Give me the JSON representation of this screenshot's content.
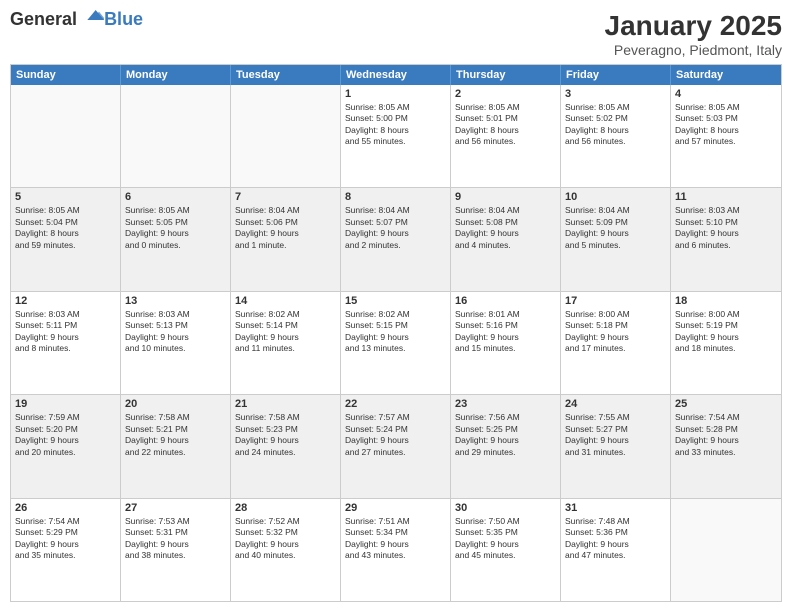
{
  "logo": {
    "line1": "General",
    "line2": "Blue"
  },
  "title": "January 2025",
  "subtitle": "Peveragno, Piedmont, Italy",
  "days": [
    "Sunday",
    "Monday",
    "Tuesday",
    "Wednesday",
    "Thursday",
    "Friday",
    "Saturday"
  ],
  "weeks": [
    [
      {
        "day": "",
        "info": ""
      },
      {
        "day": "",
        "info": ""
      },
      {
        "day": "",
        "info": ""
      },
      {
        "day": "1",
        "info": "Sunrise: 8:05 AM\nSunset: 5:00 PM\nDaylight: 8 hours\nand 55 minutes."
      },
      {
        "day": "2",
        "info": "Sunrise: 8:05 AM\nSunset: 5:01 PM\nDaylight: 8 hours\nand 56 minutes."
      },
      {
        "day": "3",
        "info": "Sunrise: 8:05 AM\nSunset: 5:02 PM\nDaylight: 8 hours\nand 56 minutes."
      },
      {
        "day": "4",
        "info": "Sunrise: 8:05 AM\nSunset: 5:03 PM\nDaylight: 8 hours\nand 57 minutes."
      }
    ],
    [
      {
        "day": "5",
        "info": "Sunrise: 8:05 AM\nSunset: 5:04 PM\nDaylight: 8 hours\nand 59 minutes."
      },
      {
        "day": "6",
        "info": "Sunrise: 8:05 AM\nSunset: 5:05 PM\nDaylight: 9 hours\nand 0 minutes."
      },
      {
        "day": "7",
        "info": "Sunrise: 8:04 AM\nSunset: 5:06 PM\nDaylight: 9 hours\nand 1 minute."
      },
      {
        "day": "8",
        "info": "Sunrise: 8:04 AM\nSunset: 5:07 PM\nDaylight: 9 hours\nand 2 minutes."
      },
      {
        "day": "9",
        "info": "Sunrise: 8:04 AM\nSunset: 5:08 PM\nDaylight: 9 hours\nand 4 minutes."
      },
      {
        "day": "10",
        "info": "Sunrise: 8:04 AM\nSunset: 5:09 PM\nDaylight: 9 hours\nand 5 minutes."
      },
      {
        "day": "11",
        "info": "Sunrise: 8:03 AM\nSunset: 5:10 PM\nDaylight: 9 hours\nand 6 minutes."
      }
    ],
    [
      {
        "day": "12",
        "info": "Sunrise: 8:03 AM\nSunset: 5:11 PM\nDaylight: 9 hours\nand 8 minutes."
      },
      {
        "day": "13",
        "info": "Sunrise: 8:03 AM\nSunset: 5:13 PM\nDaylight: 9 hours\nand 10 minutes."
      },
      {
        "day": "14",
        "info": "Sunrise: 8:02 AM\nSunset: 5:14 PM\nDaylight: 9 hours\nand 11 minutes."
      },
      {
        "day": "15",
        "info": "Sunrise: 8:02 AM\nSunset: 5:15 PM\nDaylight: 9 hours\nand 13 minutes."
      },
      {
        "day": "16",
        "info": "Sunrise: 8:01 AM\nSunset: 5:16 PM\nDaylight: 9 hours\nand 15 minutes."
      },
      {
        "day": "17",
        "info": "Sunrise: 8:00 AM\nSunset: 5:18 PM\nDaylight: 9 hours\nand 17 minutes."
      },
      {
        "day": "18",
        "info": "Sunrise: 8:00 AM\nSunset: 5:19 PM\nDaylight: 9 hours\nand 18 minutes."
      }
    ],
    [
      {
        "day": "19",
        "info": "Sunrise: 7:59 AM\nSunset: 5:20 PM\nDaylight: 9 hours\nand 20 minutes."
      },
      {
        "day": "20",
        "info": "Sunrise: 7:58 AM\nSunset: 5:21 PM\nDaylight: 9 hours\nand 22 minutes."
      },
      {
        "day": "21",
        "info": "Sunrise: 7:58 AM\nSunset: 5:23 PM\nDaylight: 9 hours\nand 24 minutes."
      },
      {
        "day": "22",
        "info": "Sunrise: 7:57 AM\nSunset: 5:24 PM\nDaylight: 9 hours\nand 27 minutes."
      },
      {
        "day": "23",
        "info": "Sunrise: 7:56 AM\nSunset: 5:25 PM\nDaylight: 9 hours\nand 29 minutes."
      },
      {
        "day": "24",
        "info": "Sunrise: 7:55 AM\nSunset: 5:27 PM\nDaylight: 9 hours\nand 31 minutes."
      },
      {
        "day": "25",
        "info": "Sunrise: 7:54 AM\nSunset: 5:28 PM\nDaylight: 9 hours\nand 33 minutes."
      }
    ],
    [
      {
        "day": "26",
        "info": "Sunrise: 7:54 AM\nSunset: 5:29 PM\nDaylight: 9 hours\nand 35 minutes."
      },
      {
        "day": "27",
        "info": "Sunrise: 7:53 AM\nSunset: 5:31 PM\nDaylight: 9 hours\nand 38 minutes."
      },
      {
        "day": "28",
        "info": "Sunrise: 7:52 AM\nSunset: 5:32 PM\nDaylight: 9 hours\nand 40 minutes."
      },
      {
        "day": "29",
        "info": "Sunrise: 7:51 AM\nSunset: 5:34 PM\nDaylight: 9 hours\nand 43 minutes."
      },
      {
        "day": "30",
        "info": "Sunrise: 7:50 AM\nSunset: 5:35 PM\nDaylight: 9 hours\nand 45 minutes."
      },
      {
        "day": "31",
        "info": "Sunrise: 7:48 AM\nSunset: 5:36 PM\nDaylight: 9 hours\nand 47 minutes."
      },
      {
        "day": "",
        "info": ""
      }
    ]
  ]
}
